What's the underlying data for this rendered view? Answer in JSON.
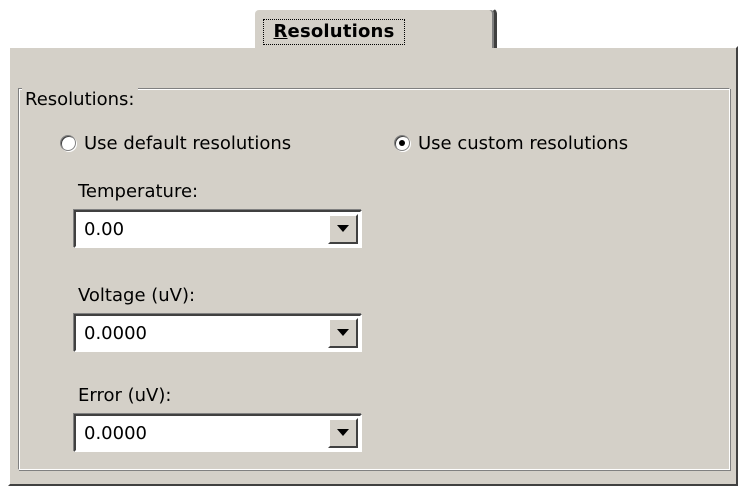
{
  "tab": {
    "label_mnemonic": "R",
    "label_rest": "esolutions"
  },
  "group": {
    "title": "Resolutions:"
  },
  "radios": {
    "default": {
      "label": "Use default resolutions",
      "selected": false
    },
    "custom": {
      "label": "Use custom resolutions",
      "selected": true
    }
  },
  "fields": {
    "temperature": {
      "label": "Temperature:",
      "value": "0.00"
    },
    "voltage": {
      "label": "Voltage (uV):",
      "value": "0.0000"
    },
    "error": {
      "label": "Error (uV):",
      "value": "0.0000"
    }
  },
  "icons": {
    "dropdown": "triangle-down",
    "radio": "circle"
  },
  "colors": {
    "face": "#d4d0c8",
    "highlight": "#ffffff",
    "shadow": "#808080",
    "dark_shadow": "#404040"
  }
}
